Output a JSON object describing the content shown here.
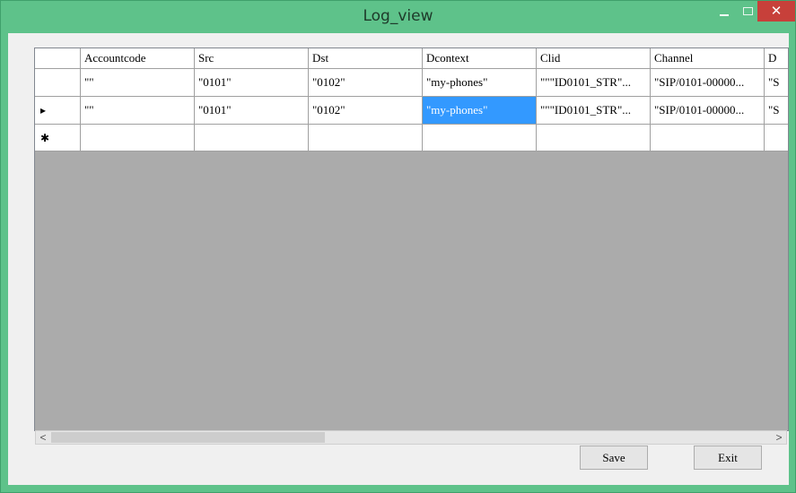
{
  "window": {
    "title": "Log_view"
  },
  "grid": {
    "columns": [
      "Accountcode",
      "Src",
      "Dst",
      "Dcontext",
      "Clid",
      "Channel",
      "D"
    ],
    "rows": [
      {
        "marker": "",
        "cells": [
          "\"\"",
          "\"0101\"",
          "\"0102\"",
          "\"my-phones\"",
          "\"\"\"ID0101_STR\"...",
          "\"SIP/0101-00000...",
          "\"S"
        ]
      },
      {
        "marker": "▸",
        "cells": [
          "\"\"",
          "\"0101\"",
          "\"0102\"",
          "\"my-phones\"",
          "\"\"\"ID0101_STR\"...",
          "\"SIP/0101-00000...",
          "\"S"
        ]
      }
    ],
    "new_row_marker": "✱",
    "selected_cell": {
      "row": 1,
      "column": 3
    }
  },
  "scrollbar": {
    "left_arrow": "<",
    "right_arrow": ">"
  },
  "buttons": {
    "save": "Save",
    "exit": "Exit"
  },
  "colors": {
    "window_frame": "#5ec28a",
    "close_button": "#c7403a",
    "selection": "#3399ff",
    "grid_background": "#ababab"
  }
}
